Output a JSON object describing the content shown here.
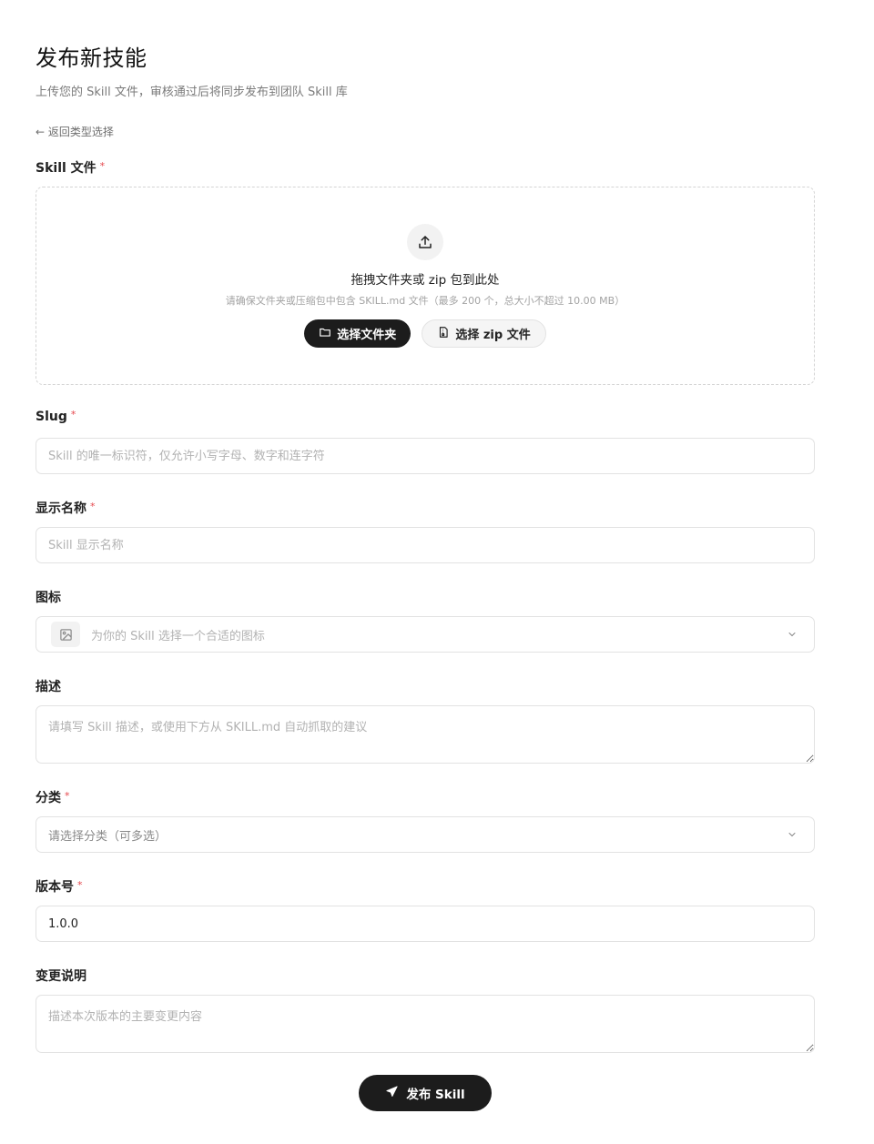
{
  "header": {
    "title": "发布新技能",
    "subtitle": "上传您的 Skill 文件，审核通过后将同步发布到团队 Skill 库",
    "back_link": "← 返回类型选择"
  },
  "upload": {
    "label": "Skill 文件",
    "required_mark": "*",
    "drop_title": "拖拽文件夹或 zip 包到此处",
    "drop_hint": "请确保文件夹或压缩包中包含 SKILL.md 文件（最多 200 个，总大小不超过 10.00 MB）",
    "select_folder_label": "选择文件夹",
    "select_zip_label": "选择 zip 文件"
  },
  "fields": {
    "slug": {
      "label": "Slug",
      "required_mark": "*",
      "placeholder": "Skill 的唯一标识符，仅允许小写字母、数字和连字符",
      "value": ""
    },
    "display_name": {
      "label": "显示名称",
      "required_mark": "*",
      "placeholder": "Skill 显示名称",
      "value": ""
    },
    "icon": {
      "label": "图标",
      "placeholder": "为你的 Skill 选择一个合适的图标"
    },
    "description": {
      "label": "描述",
      "placeholder": "请填写 Skill 描述，或使用下方从 SKILL.md 自动抓取的建议",
      "value": ""
    },
    "category": {
      "label": "分类",
      "required_mark": "*",
      "placeholder": "请选择分类（可多选）"
    },
    "version": {
      "label": "版本号",
      "required_mark": "*",
      "value": "1.0.0"
    },
    "changelog": {
      "label": "变更说明",
      "placeholder": "描述本次版本的主要变更内容",
      "value": ""
    }
  },
  "submit": {
    "label": "发布 Skill"
  },
  "colors": {
    "primary": "#1c1c1c",
    "required": "#e5484d",
    "border": "#e2e2e2"
  }
}
